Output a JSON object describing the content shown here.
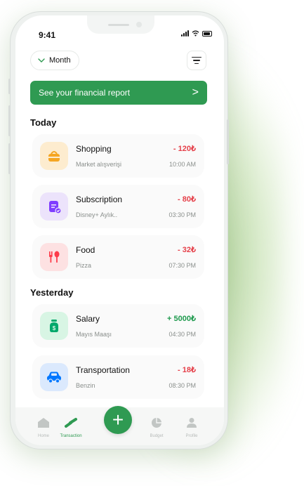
{
  "status": {
    "time": "9:41"
  },
  "header": {
    "period_label": "Month"
  },
  "report_banner": {
    "label": "See your financial report",
    "chevron": ">"
  },
  "sections": {
    "today": "Today",
    "yesterday": "Yesterday"
  },
  "transactions_today": [
    {
      "name": "Shopping",
      "desc": "Market alışverişi",
      "amount": "- 120₺",
      "time": "10:00 AM",
      "icon": "shopping-basket-icon",
      "tint": "#fdeccf",
      "color": "#f5a623"
    },
    {
      "name": "Subscription",
      "desc": "Disney+ Aylık..",
      "amount": "- 80₺",
      "time": "03:30 PM",
      "icon": "clipboard-icon",
      "tint": "#ece3fb",
      "color": "#7f3dff"
    },
    {
      "name": "Food",
      "desc": "Pizza",
      "amount": "- 32₺",
      "time": "07:30 PM",
      "icon": "fork-knife-icon",
      "tint": "#fde1e2",
      "color": "#fd3c4a"
    }
  ],
  "transactions_yesterday": [
    {
      "name": "Salary",
      "desc": "Mayıs Maaşı",
      "amount": "+ 5000₺",
      "time": "04:30 PM",
      "icon": "money-bag-icon",
      "tint": "#d8f5e4",
      "color": "#00a86b"
    },
    {
      "name": "Transportation",
      "desc": "Benzin",
      "amount": "- 18₺",
      "time": "08:30 PM",
      "icon": "car-icon",
      "tint": "#dbe9fd",
      "color": "#0077ff"
    }
  ],
  "nav": {
    "home": "Home",
    "transaction": "Transaction",
    "add": "+",
    "budget": "Budget",
    "profile": "Profile"
  },
  "colors": {
    "accent": "#2f9a52",
    "expense": "#e5404a",
    "income": "#1f9a4e"
  }
}
